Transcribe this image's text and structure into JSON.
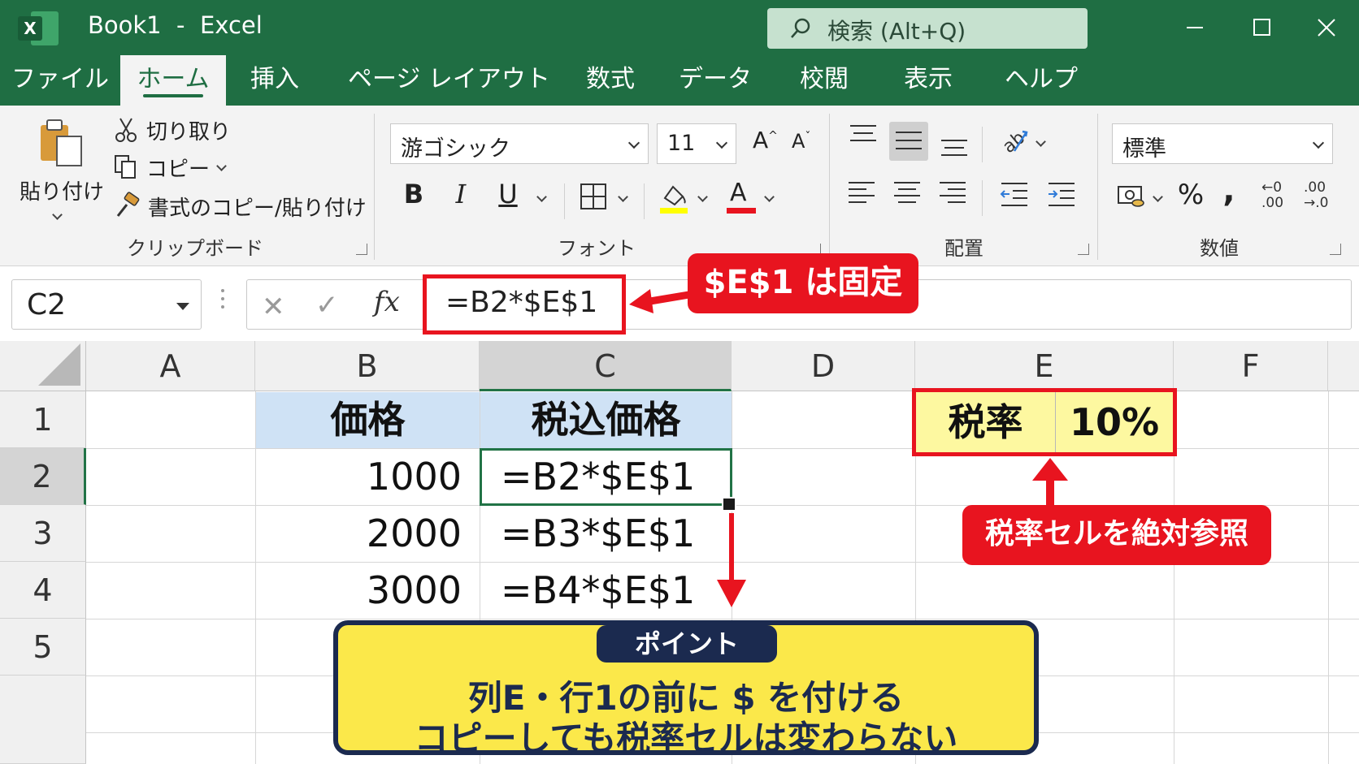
{
  "window": {
    "title": "Book1  -  Excel",
    "search_placeholder": "検索 (Alt+Q)",
    "app_icon_letter": "X"
  },
  "menu_tabs": [
    "ファイル",
    "ホーム",
    "挿入",
    "ページ レイアウト",
    "数式",
    "データ",
    "校閲",
    "表示",
    "ヘルプ"
  ],
  "active_tab": "ホーム",
  "ribbon": {
    "clipboard": {
      "paste_label": "貼り付け",
      "cut_label": "切り取り",
      "copy_label": "コピー",
      "format_painter_label": "書式のコピー/貼り付け",
      "group_label": "クリップボード"
    },
    "font": {
      "font_name": "游ゴシック",
      "font_size": "11",
      "grow_label": "A",
      "shrink_label": "A",
      "bold_label": "B",
      "italic_label": "I",
      "underline_label": "U",
      "font_color_label": "A",
      "highlight_color": "#ffff00",
      "font_color": "#e8141f",
      "group_label": "フォント"
    },
    "alignment": {
      "group_label": "配置"
    },
    "number": {
      "format": "標準",
      "percent_label": "%",
      "comma_label": ",",
      "increase_decimal_label": "←0 .00",
      "decrease_decimal_label": ".00 →.0",
      "group_label": "数値"
    }
  },
  "formula_bar": {
    "name_box": "C2",
    "cancel_label": "✕",
    "enter_label": "✓",
    "fx_label": "fx",
    "formula": "=B2*$E$1"
  },
  "sheet": {
    "columns": [
      "A",
      "B",
      "C",
      "D",
      "E",
      "F"
    ],
    "selected_column": "C",
    "rows": [
      "1",
      "2",
      "3",
      "4",
      "5"
    ],
    "selected_row": "2",
    "cells": {
      "B1": "価格",
      "C1": "税込価格",
      "B2": "1000",
      "C2": "=B2*$E$1",
      "B3": "2000",
      "C3": "=B3*$E$1",
      "B4": "3000",
      "C4": "=B4*$E$1",
      "E1": "税率",
      "F1": "10%"
    }
  },
  "annotations": {
    "fixed_label": "$E$1 は固定",
    "absolute_ref_label": "税率セルを絶対参照",
    "point_tag": "ポイント",
    "point_line1": "列E・行1の前に $ を付ける",
    "point_line2": "コピーしても税率セルは変わらない",
    "accent_red": "#e8141f",
    "tax_cell_fill": "#fdf8a0",
    "header_fill": "#cfe2f5",
    "point_fill": "#fbe84a",
    "point_border": "#1b2a4f"
  },
  "colors": {
    "excel_green": "#1f6e43",
    "ribbon_bg": "#f3f3f3"
  }
}
